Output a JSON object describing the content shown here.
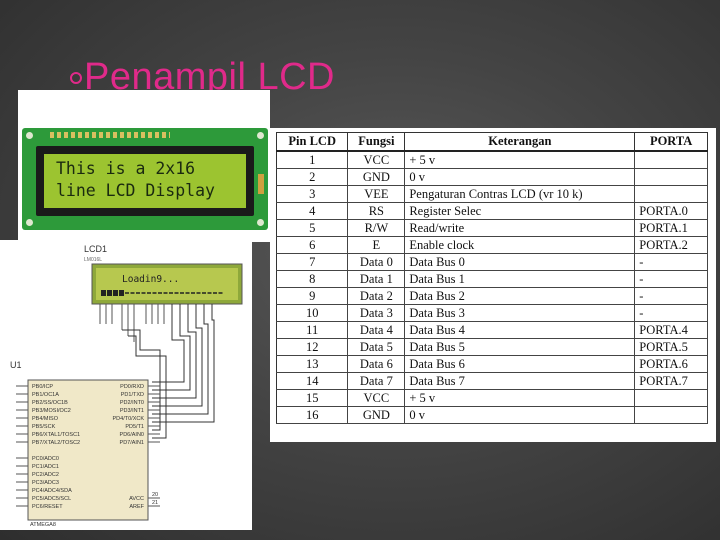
{
  "title": "Penampil LCD",
  "lcd_photo": {
    "line1": "This is a 2x16",
    "line2": "line LCD Display"
  },
  "schematic": {
    "lcd_label": "LCD1",
    "lcd_part": "LM016L",
    "lcd_text": "Loadin9...",
    "mcu_label": "U1",
    "mcu_part": "ATMEGA8",
    "left_pins": [
      "PB0/ICP",
      "PB1/OC1A",
      "PB2/SS/OC1B",
      "PB3/MOSI/OC2",
      "PB4/MISO",
      "PB5/SCK",
      "PB6/XTAL1/TOSC1",
      "PB7/XTAL2/TOSC2"
    ],
    "left_pins2": [
      "PC0/ADC0",
      "PC1/ADC1",
      "PC2/ADC2",
      "PC3/ADC3",
      "PC4/ADC4/SDA",
      "PC5/ADC5/SCL",
      "PC6/RESET"
    ],
    "right_pins": [
      "PD0/RXD",
      "PD1/TXD",
      "PD2/INT0",
      "PD3/INT1",
      "PD4/T0/XCK",
      "PD5/T1",
      "PD6/AIN0",
      "PD7/AIN1"
    ],
    "right_pins2": [
      "AVCC",
      "AREF"
    ],
    "avcc_num": "20",
    "aref_num": "21"
  },
  "table": {
    "headers": [
      "Pin LCD",
      "Fungsi",
      "Keterangan",
      "PORTA"
    ],
    "rows": [
      [
        "1",
        "VCC",
        "+ 5 v",
        ""
      ],
      [
        "2",
        "GND",
        "0 v",
        ""
      ],
      [
        "3",
        "VEE",
        "Pengaturan Contras LCD (vr 10 k)",
        ""
      ],
      [
        "4",
        "RS",
        "Register Selec",
        "PORTA.0"
      ],
      [
        "5",
        "R/W",
        "Read/write",
        "PORTA.1"
      ],
      [
        "6",
        "E",
        "Enable clock",
        "PORTA.2"
      ],
      [
        "7",
        "Data 0",
        "Data Bus 0",
        "-"
      ],
      [
        "8",
        "Data 1",
        "Data Bus 1",
        "-"
      ],
      [
        "9",
        "Data 2",
        "Data Bus 2",
        "-"
      ],
      [
        "10",
        "Data 3",
        "Data Bus 3",
        "-"
      ],
      [
        "11",
        "Data 4",
        "Data Bus  4",
        "PORTA.4"
      ],
      [
        "12",
        "Data 5",
        "Data Bus  5",
        "PORTA.5"
      ],
      [
        "13",
        "Data 6",
        "Data Bus  6",
        "PORTA.6"
      ],
      [
        "14",
        "Data 7",
        "Data Bus  7",
        "PORTA.7"
      ],
      [
        "15",
        "VCC",
        "+ 5 v",
        ""
      ],
      [
        "16",
        "GND",
        "0 v",
        ""
      ]
    ]
  },
  "colors": {
    "title": "#e02a8a",
    "background": "#444444",
    "lcd_backlight": "#9cc430",
    "pcb": "#2d9a3a"
  }
}
